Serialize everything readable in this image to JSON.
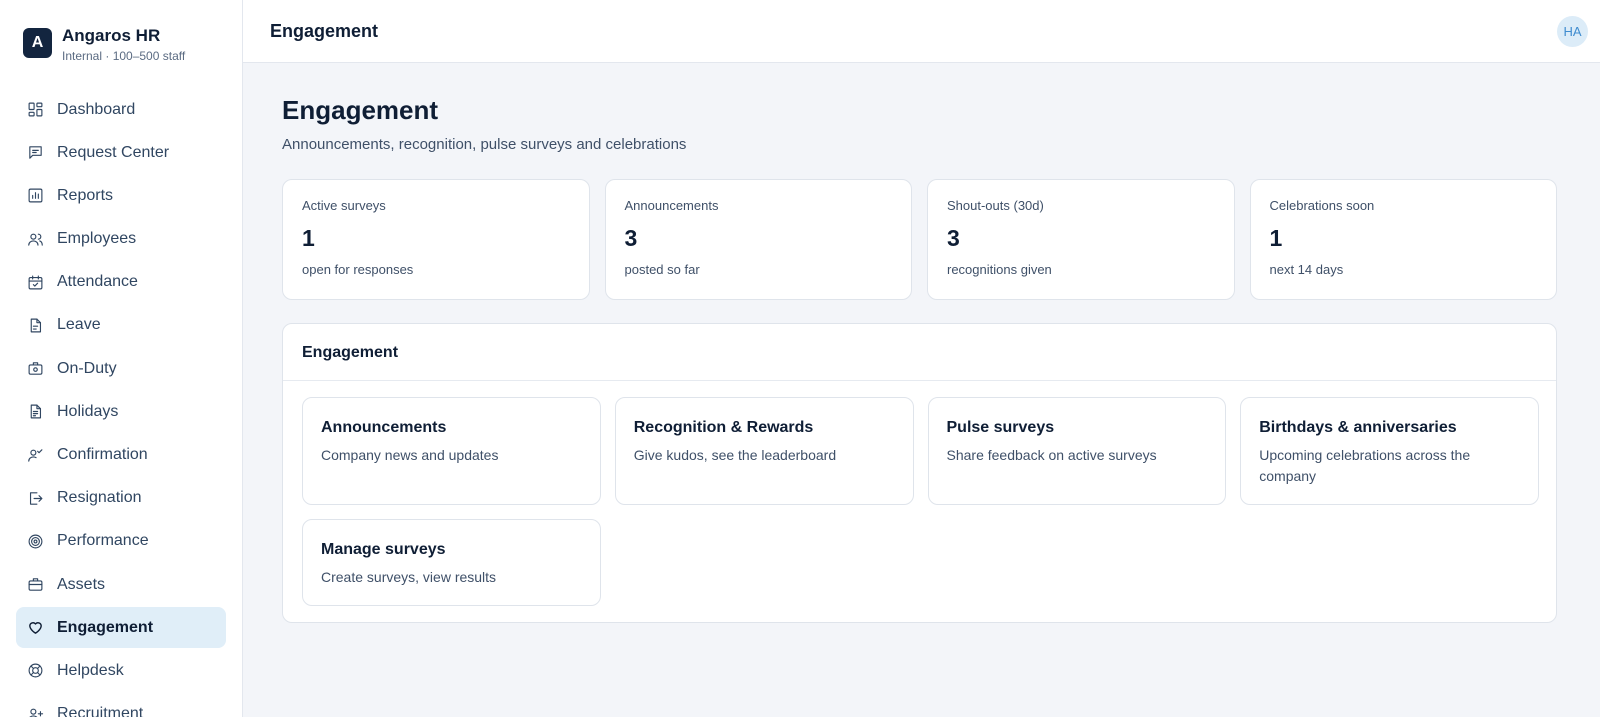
{
  "brand": {
    "initial": "A",
    "name": "Angaros HR",
    "subtitle": "Internal · 100–500 staff"
  },
  "sidebar": {
    "items": [
      {
        "label": "Dashboard",
        "icon": "dashboard-icon"
      },
      {
        "label": "Request Center",
        "icon": "message-icon"
      },
      {
        "label": "Reports",
        "icon": "bar-chart-icon"
      },
      {
        "label": "Employees",
        "icon": "users-icon"
      },
      {
        "label": "Attendance",
        "icon": "calendar-check-icon"
      },
      {
        "label": "Leave",
        "icon": "document-icon"
      },
      {
        "label": "On-Duty",
        "icon": "briefcase-clock-icon"
      },
      {
        "label": "Holidays",
        "icon": "document-list-icon"
      },
      {
        "label": "Confirmation",
        "icon": "user-check-icon"
      },
      {
        "label": "Resignation",
        "icon": "logout-icon"
      },
      {
        "label": "Performance",
        "icon": "target-icon"
      },
      {
        "label": "Assets",
        "icon": "briefcase-icon"
      },
      {
        "label": "Engagement",
        "icon": "heart-icon",
        "active": true
      },
      {
        "label": "Helpdesk",
        "icon": "lifebuoy-icon"
      },
      {
        "label": "Recruitment",
        "icon": "user-plus-icon"
      }
    ]
  },
  "header": {
    "title": "Engagement",
    "avatar_initials": "HA"
  },
  "page": {
    "title": "Engagement",
    "subtitle": "Announcements, recognition, pulse surveys and celebrations"
  },
  "stats": [
    {
      "label": "Active surveys",
      "value": "1",
      "note": "open for responses"
    },
    {
      "label": "Announcements",
      "value": "3",
      "note": "posted so far"
    },
    {
      "label": "Shout-outs (30d)",
      "value": "3",
      "note": "recognitions given"
    },
    {
      "label": "Celebrations soon",
      "value": "1",
      "note": "next 14 days"
    }
  ],
  "panel": {
    "title": "Engagement",
    "tiles": [
      {
        "title": "Announcements",
        "desc": "Company news and updates"
      },
      {
        "title": "Recognition & Rewards",
        "desc": "Give kudos, see the leaderboard"
      },
      {
        "title": "Pulse surveys",
        "desc": "Share feedback on active surveys"
      },
      {
        "title": "Birthdays & anniversaries",
        "desc": "Upcoming celebrations across the company"
      },
      {
        "title": "Manage surveys",
        "desc": "Create surveys, view results"
      }
    ]
  },
  "colors": {
    "accent": "#13253f",
    "active_bg": "#e0eef8",
    "avatar_bg": "#dcecf8",
    "avatar_fg": "#3f8ccf"
  }
}
